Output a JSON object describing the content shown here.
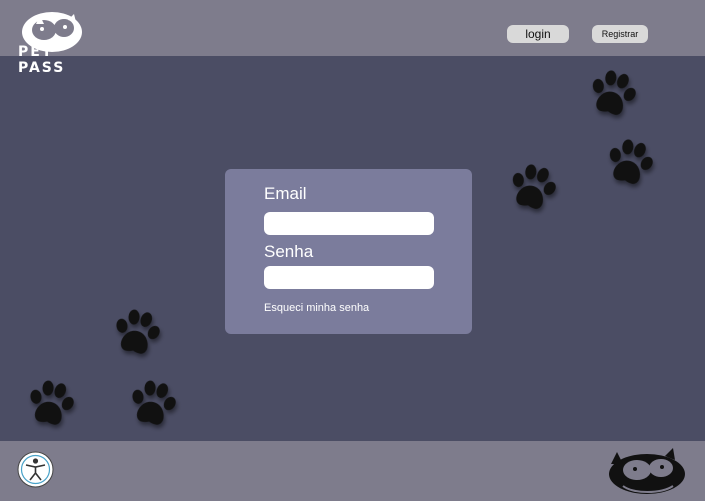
{
  "header": {
    "logo_text": "PET PASS",
    "login_label": "login",
    "register_label": "Registrar"
  },
  "form": {
    "email_label": "Email",
    "email_value": "",
    "password_label": "Senha",
    "password_value": "",
    "forgot_label": "Esqueci minha senha"
  },
  "footer": {
    "accessibility_icon": "accessibility-icon",
    "logo_icon": "pet-pass-cat-dog-icon"
  },
  "decorations": {
    "paw_icon": "paw-print-icon",
    "paw_color": "#111111"
  },
  "colors": {
    "background": "#4b4d64",
    "header": "#7e7c8c",
    "card": "#7b7c9c",
    "button": "#d9d9d9"
  }
}
